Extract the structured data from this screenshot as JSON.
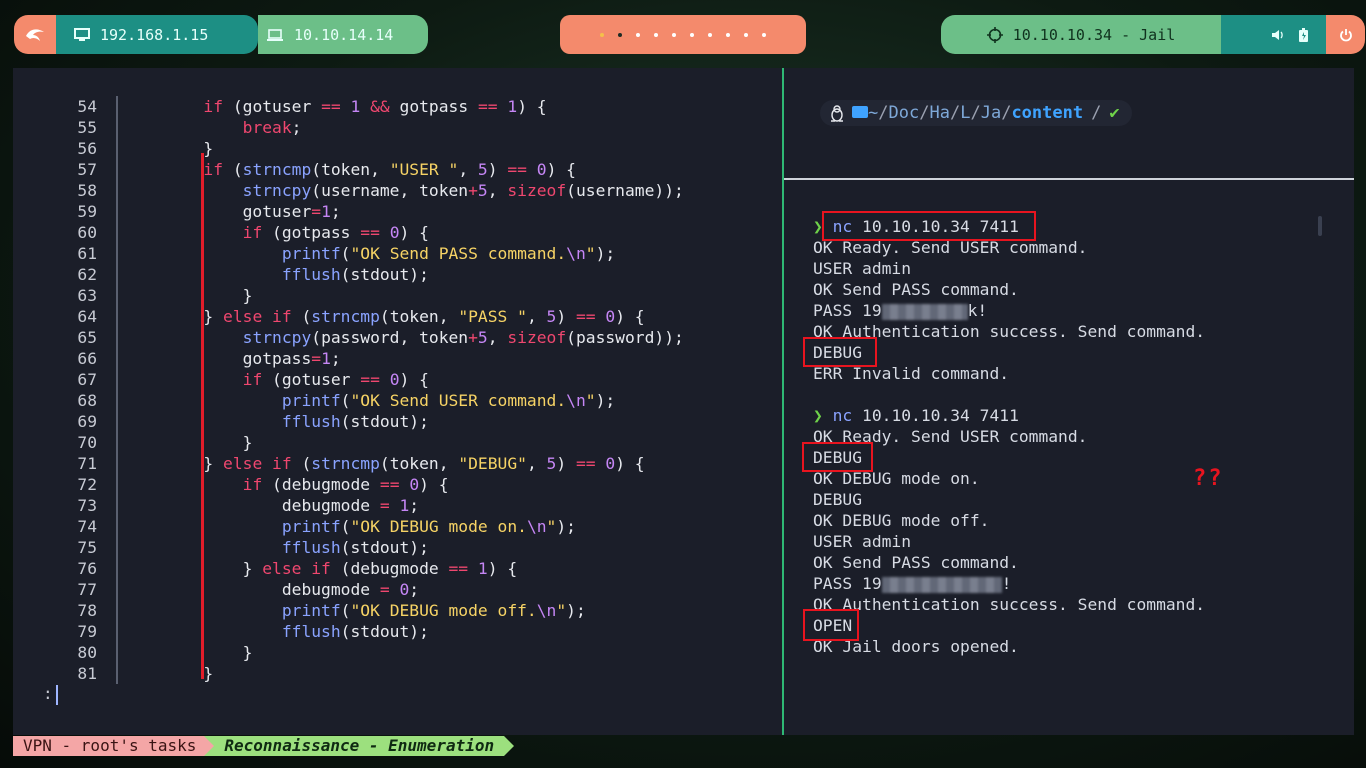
{
  "topbar": {
    "local_ip": "192.168.1.15",
    "vpn_ip": "10.10.14.14",
    "target": "10.10.10.34 - Jail",
    "workspaces": 10,
    "active_workspace": 2,
    "icons": [
      "kali-dragon-icon",
      "monitor-icon",
      "laptop-icon",
      "crosshair-icon",
      "speaker-icon",
      "battery-icon",
      "power-icon"
    ]
  },
  "editor": {
    "lines": [
      {
        "n": "54"
      },
      {
        "n": "55"
      },
      {
        "n": "56"
      },
      {
        "n": "57"
      },
      {
        "n": "58"
      },
      {
        "n": "59"
      },
      {
        "n": "60"
      },
      {
        "n": "61"
      },
      {
        "n": "62"
      },
      {
        "n": "63"
      },
      {
        "n": "64"
      },
      {
        "n": "65"
      },
      {
        "n": "66"
      },
      {
        "n": "67"
      },
      {
        "n": "68"
      },
      {
        "n": "69"
      },
      {
        "n": "70"
      },
      {
        "n": "71"
      },
      {
        "n": "72"
      },
      {
        "n": "73"
      },
      {
        "n": "74"
      },
      {
        "n": "75"
      },
      {
        "n": "76"
      },
      {
        "n": "77"
      },
      {
        "n": "78"
      },
      {
        "n": "79"
      },
      {
        "n": "80"
      },
      {
        "n": "81"
      }
    ],
    "pager_prompt": ":"
  },
  "prompt": {
    "path_home": "~",
    "p1": "Doc",
    "p2": "Ha",
    "p3": "L",
    "p4": "Ja",
    "current": "content",
    "sep": "/",
    "status": "✔"
  },
  "terminal": {
    "cmd1": "nc",
    "args1": "10.10.10.34 7411",
    "out": [
      "OK Ready. Send USER command.",
      "USER admin",
      "OK Send PASS command.",
      "PASS 19",
      "k!",
      "OK Authentication success. Send command.",
      "DEBUG",
      "ERR Invalid command."
    ],
    "cmd2": "nc",
    "args2": "10.10.10.34 7411",
    "out2": [
      "OK Ready. Send USER command.",
      "DEBUG",
      "OK DEBUG mode on.",
      "DEBUG",
      "OK DEBUG mode off.",
      "USER admin",
      "OK Send PASS command.",
      "PASS 19",
      "!",
      "OK Authentication success. Send command.",
      "OPEN",
      "OK Jail doors opened."
    ],
    "annotation": "??"
  },
  "statusbar": {
    "session": "VPN - root's tasks",
    "window": "Reconnaissance - Enumeration"
  },
  "colors": {
    "accent_green": "#2fb874",
    "salmon": "#f48a6c",
    "teal": "#1d8f84",
    "highlight_red": "#e8141f"
  }
}
